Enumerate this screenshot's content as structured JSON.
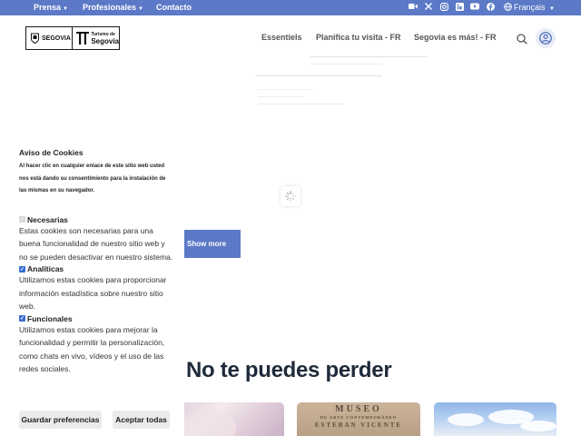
{
  "topbar": {
    "prensa": "Prensa",
    "profesionales": "Profesionales",
    "contacto": "Contacto",
    "language": "Français",
    "social_icons": [
      "video-icon",
      "x-icon",
      "instagram-icon",
      "linkedin-icon",
      "youtube-icon",
      "facebook-icon",
      "globe-icon"
    ]
  },
  "header": {
    "logo_left": "SEGOVIA",
    "logo_right_line1": "Turismo de",
    "logo_right_line2": "Segovia",
    "nav": [
      "Essentiels",
      "Planifica tu visita - FR",
      "Segovia es más! - FR"
    ]
  },
  "main": {
    "show_more": "Show more",
    "section_title": "No te puedes perder",
    "card2_line1": "MUSEO",
    "card2_line2": "DE ARTE CONTEMPORÁNEO",
    "card2_line3": "ESTEBAN VICENTE"
  },
  "cookie": {
    "title": "Aviso de Cookies",
    "lead": "Al hacer clic en cualquier enlace de este sitio web usted nos está dando su consentimiento para la instalación de las mismas en su navegador.",
    "necesarias_label": "Necesarias",
    "necesarias_desc": "Estas cookies son necesarias para una buena funcionalidad de nuestro sitio web y no se pueden desactivar en nuestro sistema.",
    "analiticas_label": "Analíticas",
    "analiticas_desc": "Utilizamos estas cookies para proporcionar información estadística sobre nuestro sitio web.",
    "funcionales_label": "Funcionales",
    "funcionales_desc": "Utilizamos estas cookies para mejorar la funcionalidad y permitir la personalización, como chats en vivo, vídeos y el uso de las redes sociales.",
    "save_button": "Guardar preferencias",
    "accept_button": "Aceptar todas"
  },
  "colors": {
    "brand_blue": "#5b79c6",
    "checkbox_blue": "#3b6fd1"
  }
}
